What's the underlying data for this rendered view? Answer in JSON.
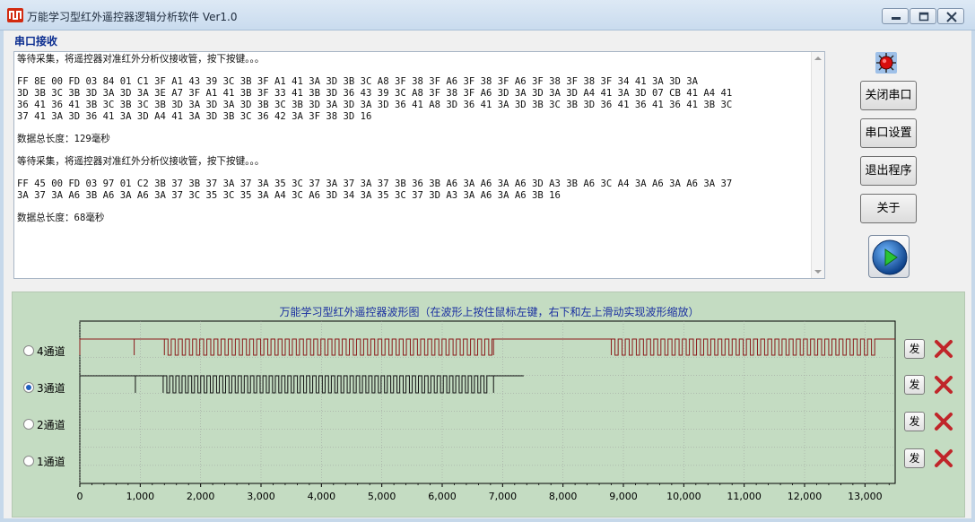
{
  "window": {
    "title": "万能学习型红外遥控器逻辑分析软件  Ver1.0",
    "app_icon": "logic-analyzer-icon",
    "controls": [
      "minimize-icon",
      "maximize-icon",
      "close-icon"
    ]
  },
  "serial": {
    "label": "串口接收",
    "lines": [
      "等待采集，将遥控器对准红外分析仪接收管，按下按键。。。",
      "",
      "FF 8E 00 FD 03 84 01 C1 3F A1 43 39 3C 3B 3F A1 41 3A 3D 3B 3C A8 3F 38 3F A6 3F 38 3F A6 3F 38 3F 38 3F 34 41 3A 3D 3A",
      "3D 3B 3C 3B 3D 3A 3D 3A 3E A7 3F A1 41 3B 3F 33 41 3B 3D 36 43 39 3C A8 3F 38 3F A6 3D 3A 3D 3A 3D A4 41 3A 3D 07 CB 41 A4 41",
      "36 41 36 41 3B 3C 3B 3C 3B 3D 3A 3D 3A 3D 3B 3C 3B 3D 3A 3D 3A 3D 36 41 A8 3D 36 41 3A 3D 3B 3C 3B 3D 36 41 36 41 36 41 3B 3C",
      "37 41 3A 3D 36 41 3A 3D A4 41 3A 3D 3B 3C 36 42 3A 3F 38 3D 16",
      "",
      "数据总长度：129毫秒",
      "",
      "等待采集，将遥控器对准红外分析仪接收管，按下按键。。。",
      "",
      "FF 45 00 FD 03 97 01 C2 3B 37 3B 37 3A 37 3A 35 3C 37 3A 37 3A 37 3B 36 3B A6 3A A6 3A A6 3D A3 3B A6 3C A4 3A A6 3A A6 3A 37",
      "3A 37 3A A6 3B A6 3A A6 3A 37 3C 35 3C 35 3A A4 3C A6 3D 34 3A 35 3C 37 3D A3 3A A6 3A A6 3B 16",
      "",
      "数据总长度：68毫秒"
    ]
  },
  "buttons": {
    "close_port": "关闭串口",
    "port_settings": "串口设置",
    "exit": "退出程序",
    "about": "关于",
    "play_icon": "play-icon",
    "status_led": "red-led-icon"
  },
  "waveform": {
    "title": "万能学习型红外遥控器波形图（在波形上按住鼠标左键，右下和左上滑动实现波形缩放）",
    "channels": [
      {
        "label": "4通道",
        "selected": false,
        "send": "发"
      },
      {
        "label": "3通道",
        "selected": true,
        "send": "发"
      },
      {
        "label": "2通道",
        "selected": false,
        "send": "发"
      },
      {
        "label": "1通道",
        "selected": false,
        "send": "发"
      }
    ],
    "x_ticks": [
      "0",
      "1,000",
      "2,000",
      "3,000",
      "4,000",
      "5,000",
      "6,000",
      "7,000",
      "8,000",
      "9,000",
      "10,000",
      "11,000",
      "12,000",
      "13,000"
    ],
    "x_max": 13500,
    "colors": {
      "channel4": "#8b1a1a",
      "channel3": "#111111",
      "grid": "#9a9a9a",
      "delete": "#c0262a"
    }
  }
}
